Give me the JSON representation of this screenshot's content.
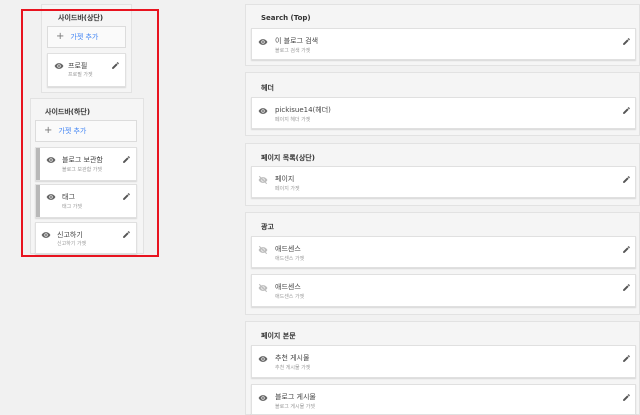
{
  "sidebar_top": {
    "title": "사이드바(상단)",
    "add_label": "가젯 추가",
    "gadgets": [
      {
        "title": "프로필",
        "sub": "프로필 가젯"
      }
    ]
  },
  "sidebar_bottom": {
    "title": "사이드바(하단)",
    "add_label": "가젯 추가",
    "gadgets": [
      {
        "title": "블로그 보관함",
        "sub": "블로그 보관함 가젯"
      },
      {
        "title": "태그",
        "sub": "태그 가젯"
      },
      {
        "title": "신고하기",
        "sub": "신고하기 가젯"
      }
    ]
  },
  "right_sections": [
    {
      "title": "Search (Top)",
      "gadgets": [
        {
          "title": "이 블로그 검색",
          "sub": "블로그 검색 가젯"
        }
      ]
    },
    {
      "title": "헤더",
      "gadgets": [
        {
          "title": "pickisue14(헤더)",
          "sub": "페이지 헤더 가젯"
        }
      ]
    },
    {
      "title": "페이지 목록(상단)",
      "gadgets": [
        {
          "title": "페이지",
          "sub": "페이지 가젯"
        }
      ]
    },
    {
      "title": "광고",
      "gadgets": [
        {
          "title": "애드센스",
          "sub": "애드센스 가젯"
        },
        {
          "title": "애드센스",
          "sub": "애드센스 가젯"
        }
      ]
    },
    {
      "title": "페이지 본문",
      "gadgets": [
        {
          "title": "추천 게시물",
          "sub": "추천 게시물 가젯"
        },
        {
          "title": "블로그 게시물",
          "sub": "블로그 게시물 가젯"
        }
      ]
    }
  ],
  "colors": {
    "highlight": "#e8131f",
    "link": "#4285f4",
    "eye_visible": "#666666",
    "eye_hidden": "#bdbdbd"
  }
}
